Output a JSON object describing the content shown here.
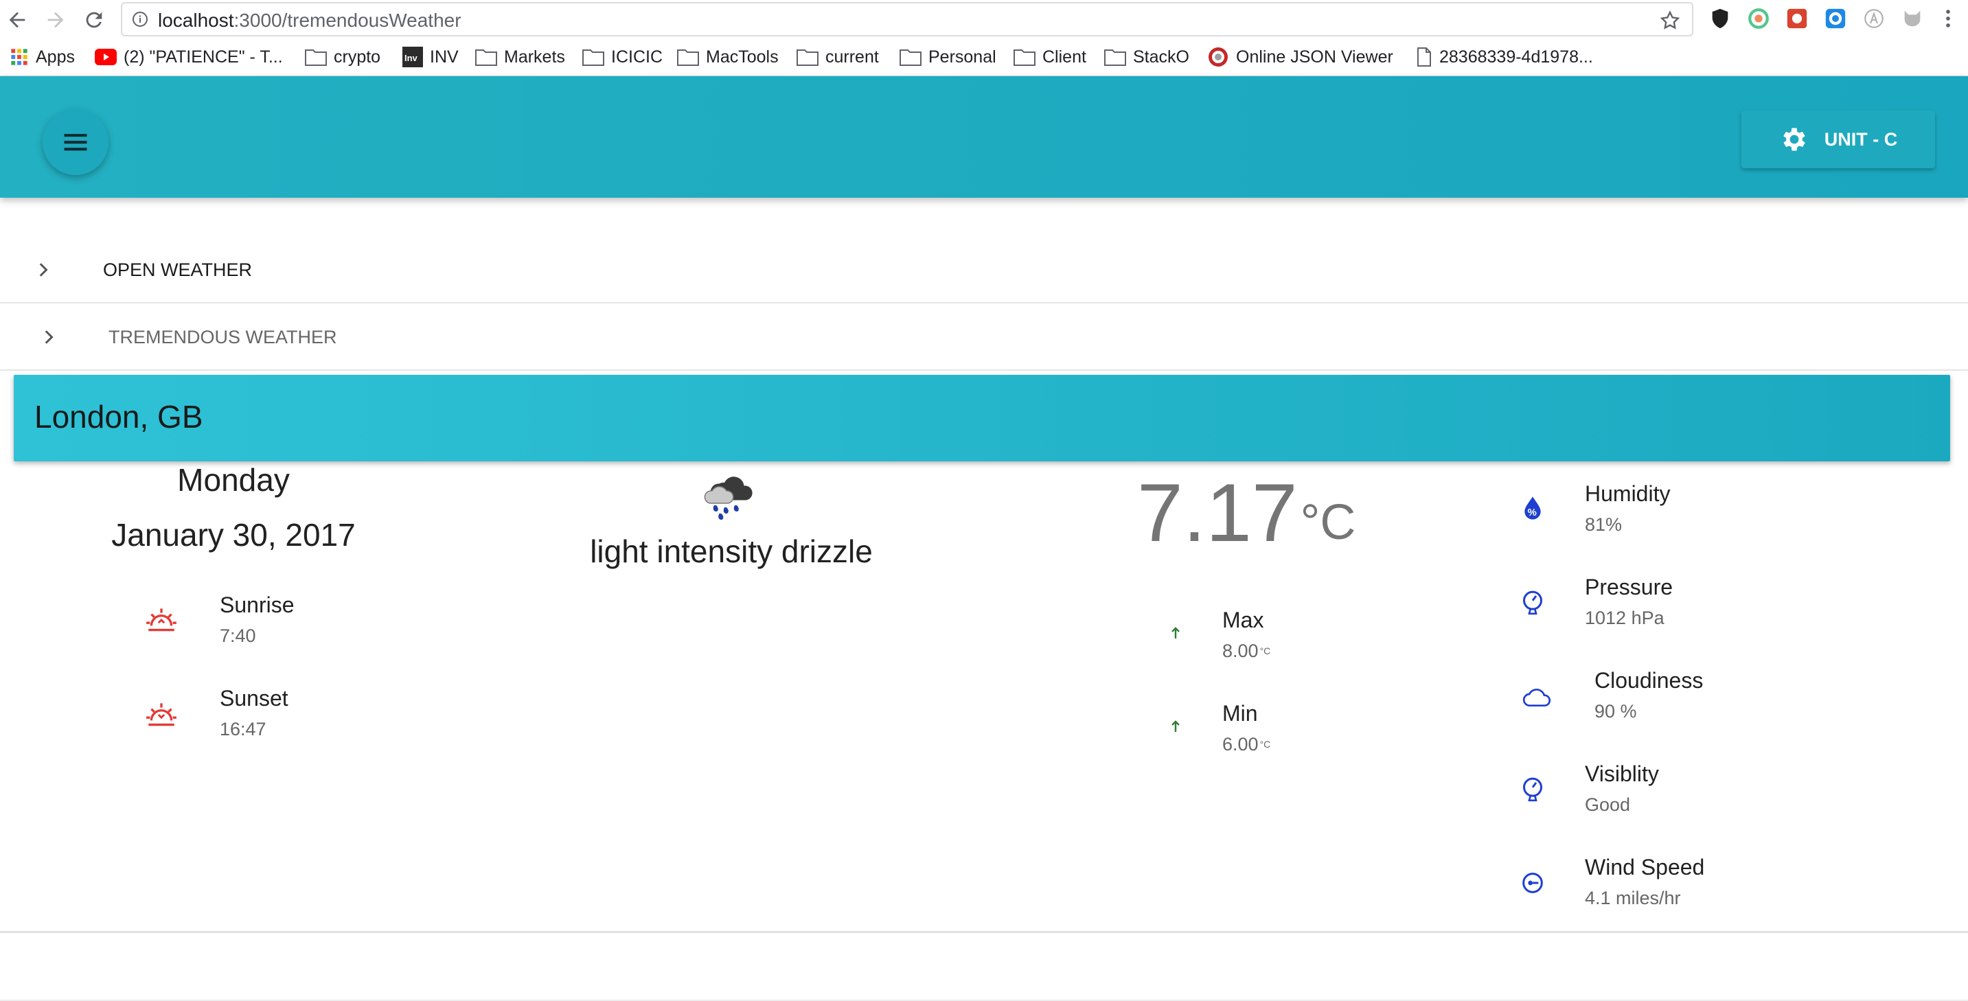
{
  "browser": {
    "url_host": "localhost",
    "url_path": ":3000/tremendousWeather",
    "bookmarks": [
      {
        "label": "Apps",
        "icon": "apps-grid-icon"
      },
      {
        "label": "(2) \"PATIENCE\" - T...",
        "icon": "youtube-icon"
      },
      {
        "label": "crypto",
        "icon": "folder-icon"
      },
      {
        "label": "INV",
        "icon": "inv-logo-icon"
      },
      {
        "label": "Markets",
        "icon": "folder-icon"
      },
      {
        "label": "ICICIC",
        "icon": "folder-icon"
      },
      {
        "label": "MacTools",
        "icon": "folder-icon"
      },
      {
        "label": "current",
        "icon": "folder-icon"
      },
      {
        "label": "Personal",
        "icon": "folder-icon"
      },
      {
        "label": "Client",
        "icon": "folder-icon"
      },
      {
        "label": "StackO",
        "icon": "folder-icon"
      },
      {
        "label": "Online JSON Viewer",
        "icon": "json-viewer-icon"
      },
      {
        "label": "28368339-4d1978...",
        "icon": "file-icon"
      }
    ]
  },
  "appbar": {
    "unit_label": "UNIT - C",
    "colors": {
      "primary": "#1fa9be",
      "accent": "#2fc2d6"
    }
  },
  "accordion": {
    "open_weather": "OPEN WEATHER",
    "tremendous_weather": "TREMENDOUS WEATHER"
  },
  "weather": {
    "city": "London, GB",
    "day": "Monday",
    "date": "January 30, 2017",
    "sunrise": {
      "label": "Sunrise",
      "value": "7:40"
    },
    "sunset": {
      "label": "Sunset",
      "value": "16:47"
    },
    "condition": "light intensity drizzle",
    "condition_icon": "rain-cloud-icon",
    "temperature": "7.17",
    "temp_unit": "°C",
    "max": {
      "label": "Max",
      "value": "8.00",
      "unit": "°C"
    },
    "min": {
      "label": "Min",
      "value": "6.00",
      "unit": "°C"
    },
    "humidity": {
      "label": "Humidity",
      "value": "81%"
    },
    "pressure": {
      "label": "Pressure",
      "value": "1012 hPa"
    },
    "cloudiness": {
      "label": "Cloudiness",
      "value": "90 %"
    },
    "visibility": {
      "label": "Visiblity",
      "value": "Good"
    },
    "wind": {
      "label": "Wind Speed",
      "value": "4.1 miles/hr"
    }
  }
}
